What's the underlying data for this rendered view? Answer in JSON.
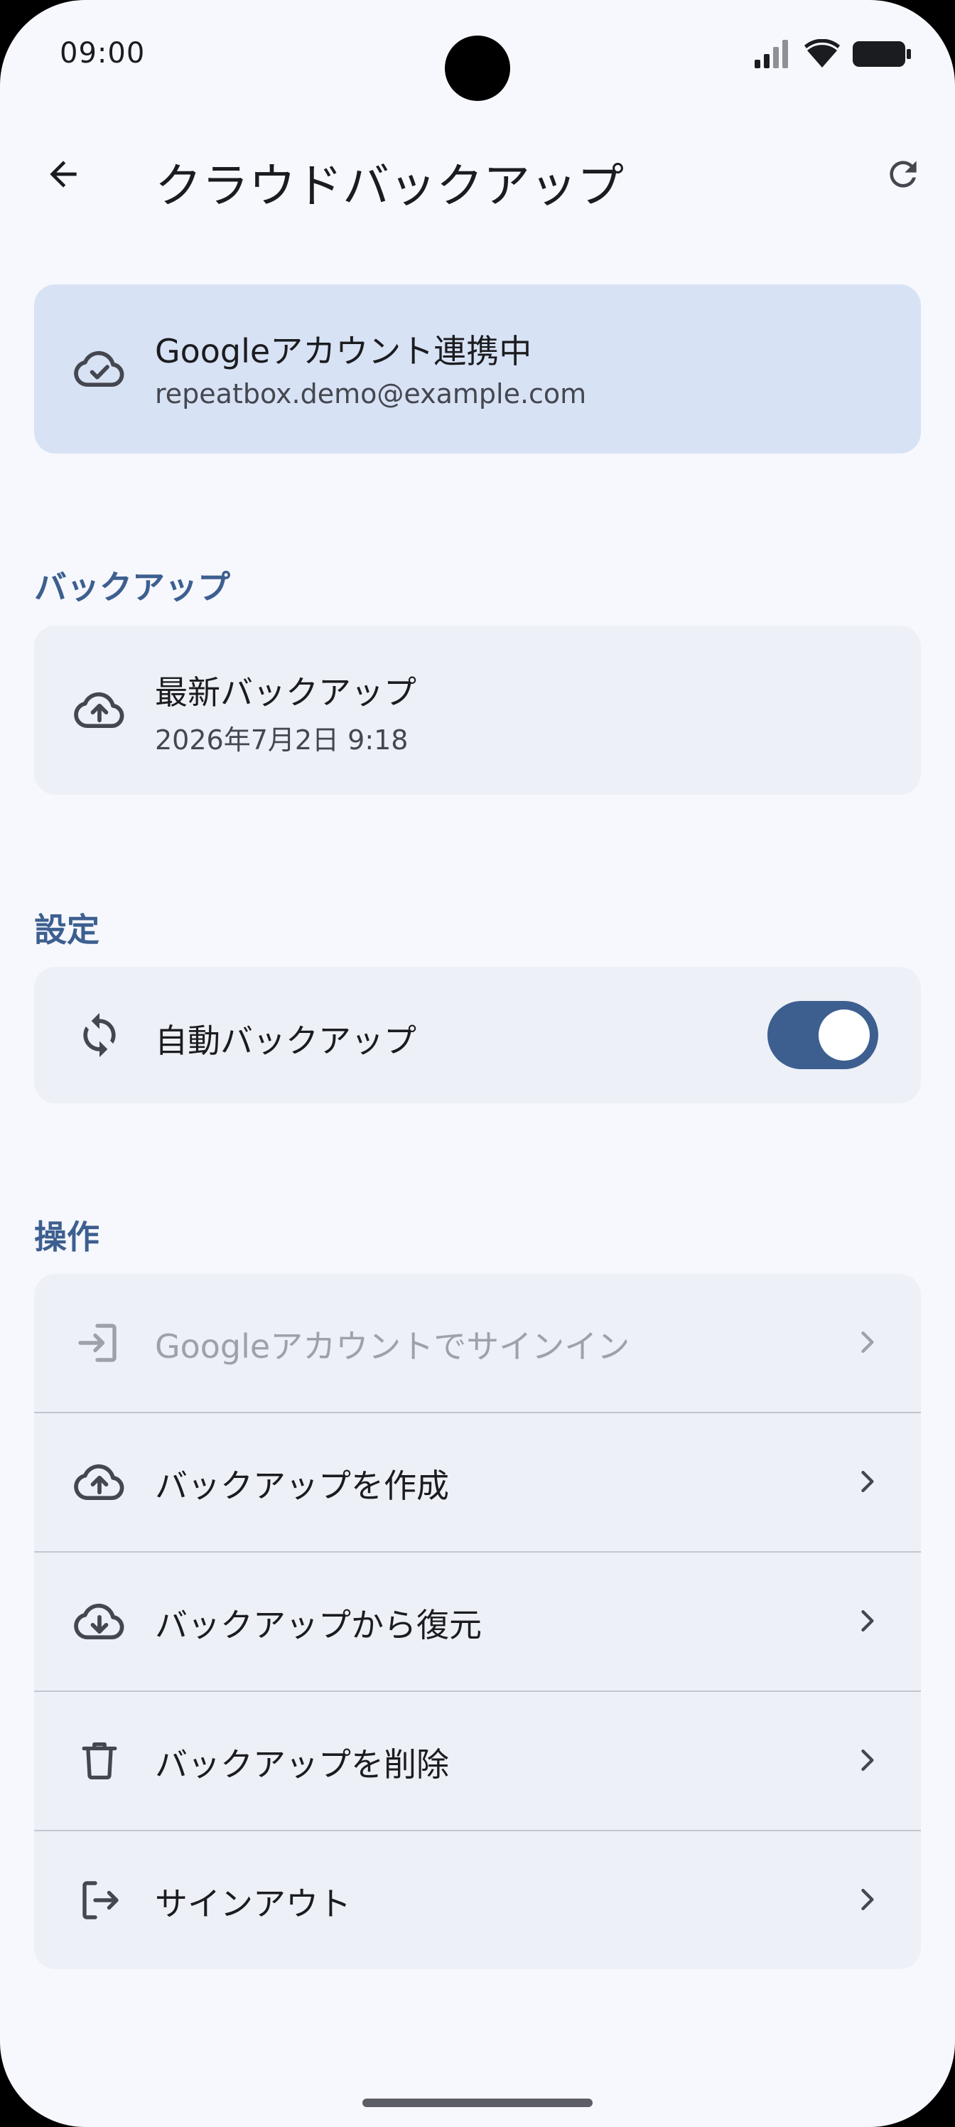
{
  "status_bar": {
    "time": "09:00"
  },
  "app_bar": {
    "title": "クラウドバックアップ"
  },
  "account": {
    "status": "Googleアカウント連携中",
    "email": "repeatbox.demo@example.com"
  },
  "backup_section": {
    "header": "バックアップ",
    "latest_label": "最新バックアップ",
    "latest_value": "2026年7月2日 9:18"
  },
  "settings_section": {
    "header": "設定",
    "auto_backup_label": "自動バックアップ",
    "auto_backup_enabled": true
  },
  "actions_section": {
    "header": "操作",
    "items": [
      {
        "label": "Googleアカウントでサインイン",
        "icon": "login-icon",
        "enabled": false
      },
      {
        "label": "バックアップを作成",
        "icon": "cloud-upload-icon",
        "enabled": true
      },
      {
        "label": "バックアップから復元",
        "icon": "cloud-download-icon",
        "enabled": true
      },
      {
        "label": "バックアップを削除",
        "icon": "trash-icon",
        "enabled": true
      },
      {
        "label": "サインアウト",
        "icon": "logout-icon",
        "enabled": true
      }
    ]
  },
  "colors": {
    "accent": "#3d5f90",
    "account_card_bg": "#d8e2f5",
    "card_bg": "#eef0f7",
    "page_bg": "#f7f8fd"
  }
}
